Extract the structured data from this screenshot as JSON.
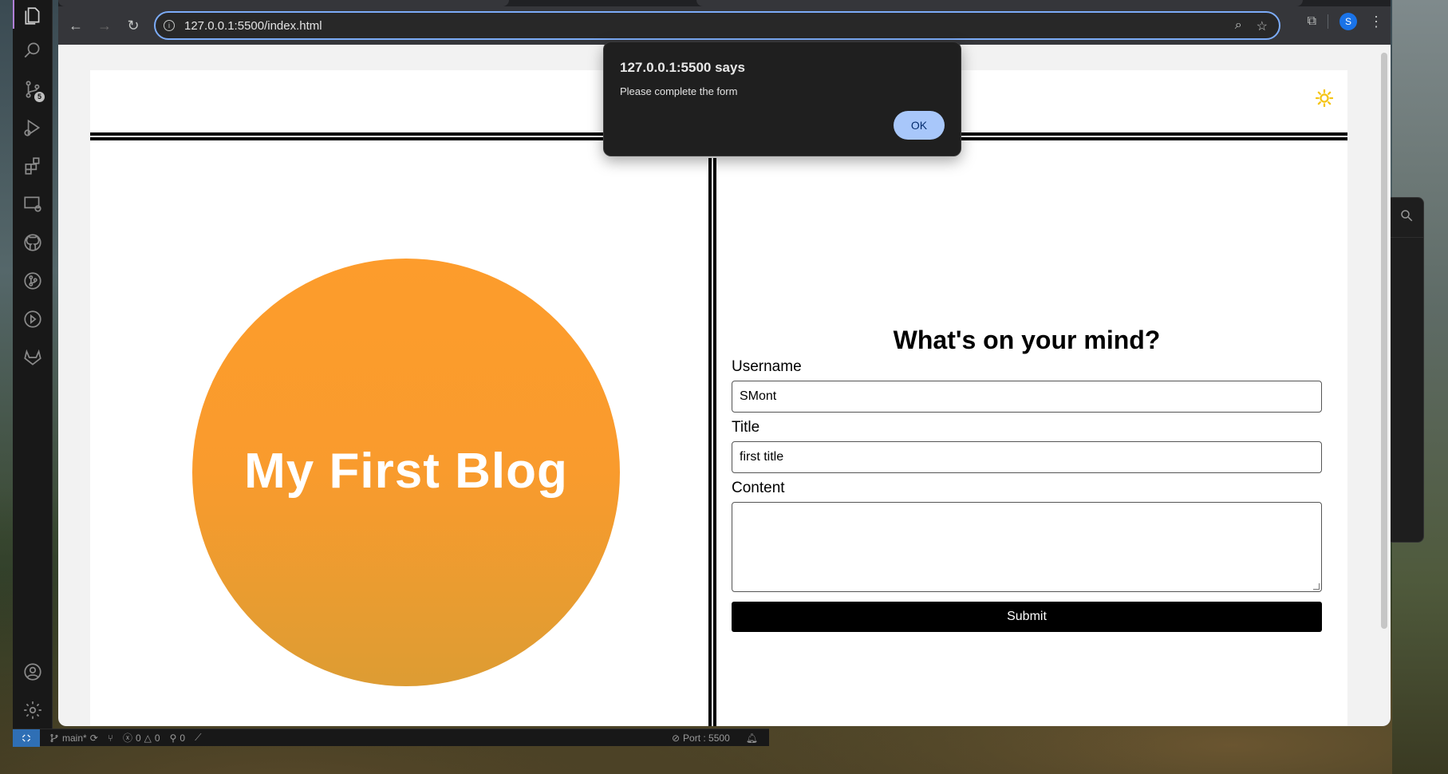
{
  "browser": {
    "url": "127.0.0.1:5500/index.html",
    "profile_initial": "S"
  },
  "alert": {
    "title": "127.0.0.1:5500 says",
    "message": "Please complete the form",
    "ok_label": "OK"
  },
  "page": {
    "hero_title": "My First Blog",
    "form": {
      "heading": "What's on your mind?",
      "username_label": "Username",
      "username_value": "SMont",
      "title_label": "Title",
      "title_value": "first title",
      "content_label": "Content",
      "content_value": "",
      "submit_label": "Submit"
    },
    "theme_icon": "sun-icon",
    "accent_color": "#fd9c2c",
    "sun_color": "#f5c518"
  },
  "vscode": {
    "source_control_badge": "5",
    "status": {
      "branch": "main*",
      "errors": "0",
      "warnings": "0",
      "ports": "0",
      "port_label": "Port : 5500"
    }
  }
}
